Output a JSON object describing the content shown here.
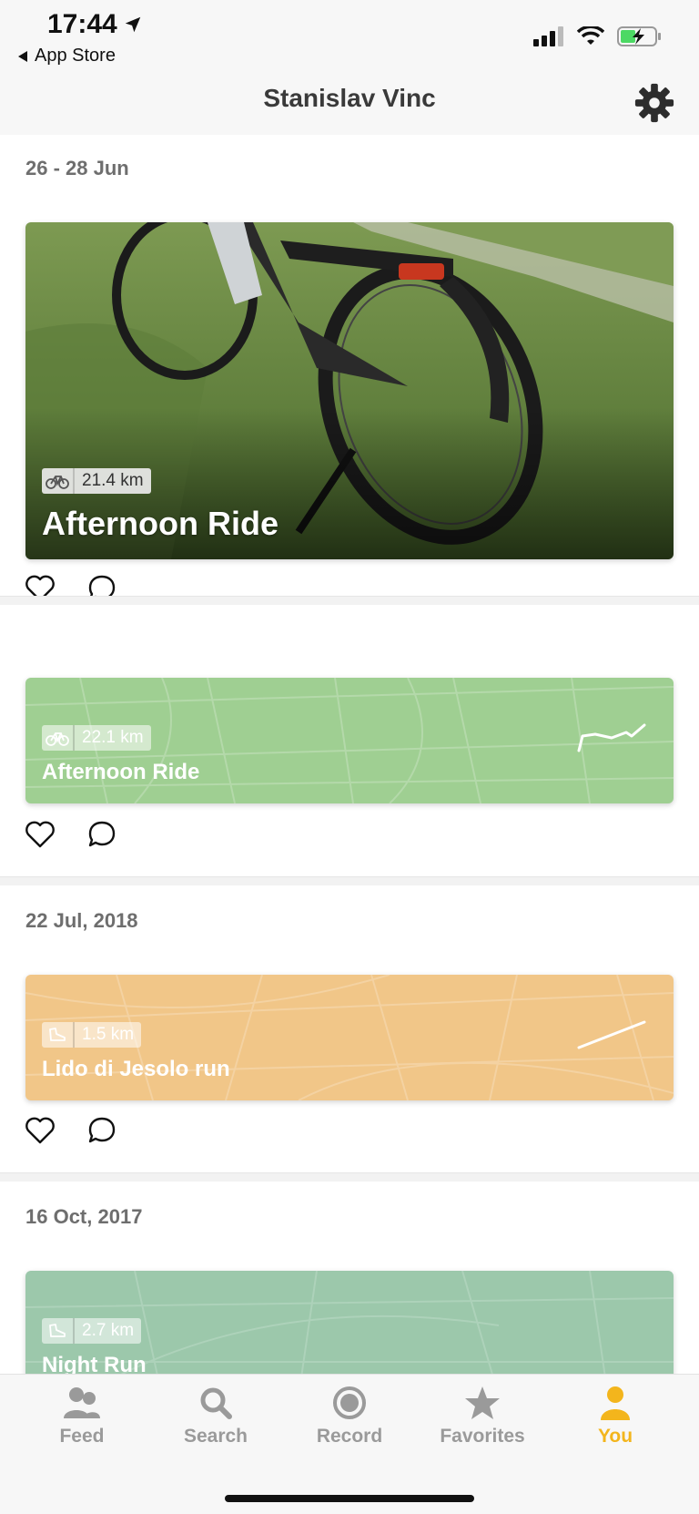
{
  "status_bar": {
    "time": "17:44",
    "back_app": "App Store"
  },
  "header": {
    "title": "Stanislav Vinc",
    "settings_icon": "gear-icon"
  },
  "feed": {
    "sections": [
      {
        "date": "26 - 28 Jun",
        "activities": [
          {
            "type": "bike",
            "distance": "21.4 km",
            "title": "Afternoon Ride",
            "style": "photo"
          },
          {
            "type": "bike",
            "distance": "22.1 km",
            "title": "Afternoon Ride",
            "style": "map",
            "color": "#9fcf92"
          }
        ]
      },
      {
        "date": "22 Jul, 2018",
        "activities": [
          {
            "type": "run",
            "distance": "1.5 km",
            "title": "Lido di Jesolo run",
            "style": "map",
            "color": "#f1c688"
          }
        ]
      },
      {
        "date": "16 Oct, 2017",
        "activities": [
          {
            "type": "run",
            "distance": "2.7 km",
            "title": "Night Run",
            "style": "map",
            "color": "#9cc8ab"
          }
        ]
      }
    ],
    "like_icon": "heart-icon",
    "comment_icon": "comment-icon"
  },
  "tabbar": {
    "tabs": [
      {
        "label": "Feed",
        "icon": "people-icon",
        "active": false
      },
      {
        "label": "Search",
        "icon": "search-icon",
        "active": false
      },
      {
        "label": "Record",
        "icon": "record-icon",
        "active": false
      },
      {
        "label": "Favorites",
        "icon": "star-icon",
        "active": false
      },
      {
        "label": "You",
        "icon": "person-icon",
        "active": true
      }
    ],
    "active_color": "#f3b51c",
    "inactive_color": "#9a9a9a"
  }
}
